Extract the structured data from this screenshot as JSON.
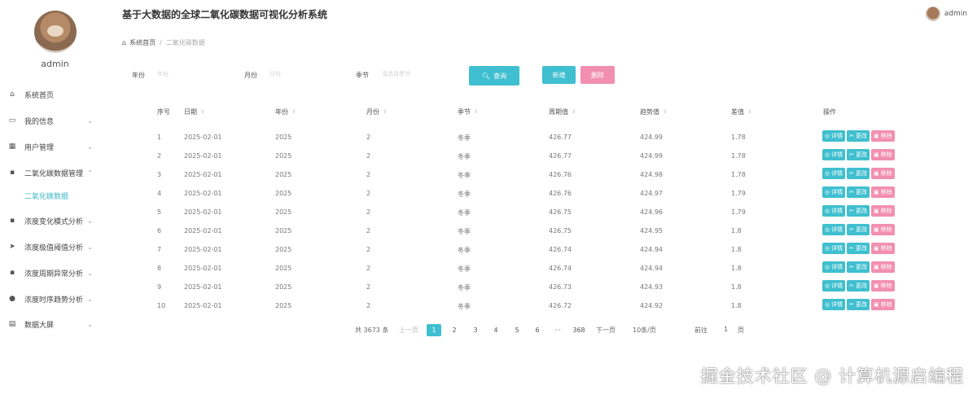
{
  "app": {
    "title": "基于大数据的全球二氧化碳数据可视化分析系统",
    "user": "admin"
  },
  "sidebar": {
    "user": "admin",
    "items": [
      {
        "label": "系统首页",
        "icon": "home-icon"
      },
      {
        "label": "我的信息",
        "icon": "calendar-icon"
      },
      {
        "label": "用户管理",
        "icon": "grid-icon"
      },
      {
        "label": "二氧化碳数据管理",
        "icon": "apps-icon"
      },
      {
        "label": "浓度变化模式分析",
        "icon": "apps-icon"
      },
      {
        "label": "浓度极值阈值分析",
        "icon": "send-icon"
      },
      {
        "label": "浓度周期异常分析",
        "icon": "apps-icon"
      },
      {
        "label": "浓度时序趋势分析",
        "icon": "user-icon"
      },
      {
        "label": "数据大屏",
        "icon": "chart-icon"
      }
    ],
    "sub_item": "二氧化碳数据"
  },
  "breadcrumb": {
    "home": "系统首页",
    "current": "二氧化碳数据"
  },
  "filters": {
    "year_label": "年份",
    "year_placeholder": "年份",
    "month_label": "月份",
    "month_placeholder": "月份",
    "season_label": "季节",
    "season_placeholder": "请选择季节"
  },
  "buttons": {
    "search": "查询",
    "add": "新增",
    "delete": "删除"
  },
  "table": {
    "headers": [
      "序号",
      "日期",
      "年份",
      "月份",
      "季节",
      "周期值",
      "趋势值",
      "差值",
      "操作"
    ],
    "rows": [
      [
        "1",
        "2025-02-01",
        "2025",
        "2",
        "冬季",
        "426.77",
        "424.99",
        "1.78"
      ],
      [
        "2",
        "2025-02-01",
        "2025",
        "2",
        "冬季",
        "426.77",
        "424.99",
        "1.78"
      ],
      [
        "3",
        "2025-02-01",
        "2025",
        "2",
        "冬季",
        "426.76",
        "424.98",
        "1.78"
      ],
      [
        "4",
        "2025-02-01",
        "2025",
        "2",
        "冬季",
        "426.76",
        "424.97",
        "1.79"
      ],
      [
        "5",
        "2025-02-01",
        "2025",
        "2",
        "冬季",
        "426.75",
        "424.96",
        "1.79"
      ],
      [
        "6",
        "2025-02-01",
        "2025",
        "2",
        "冬季",
        "426.75",
        "424.95",
        "1.8"
      ],
      [
        "7",
        "2025-02-01",
        "2025",
        "2",
        "冬季",
        "426.74",
        "424.94",
        "1.8"
      ],
      [
        "8",
        "2025-02-01",
        "2025",
        "2",
        "冬季",
        "426.74",
        "424.94",
        "1.8"
      ],
      [
        "9",
        "2025-02-01",
        "2025",
        "2",
        "冬季",
        "426.73",
        "424.93",
        "1.8"
      ],
      [
        "10",
        "2025-02-01",
        "2025",
        "2",
        "冬季",
        "426.72",
        "424.92",
        "1.8"
      ]
    ],
    "actions": {
      "detail": "详情",
      "edit": "更改",
      "remove": "移除"
    }
  },
  "pagination": {
    "total": "共 3673 条",
    "prev": "上一页",
    "pages": [
      "1",
      "2",
      "3",
      "4",
      "5",
      "6"
    ],
    "ellipsis": "···",
    "last": "368",
    "next": "下一页",
    "page_size": "10条/页",
    "goto_prefix": "前往",
    "goto_value": "1",
    "goto_suffix": "页"
  },
  "watermark": "掘金技术社区 @ 计算机源启编程",
  "colors": {
    "primary": "#3fbfcf",
    "danger": "#f28fb0",
    "active_menu": "#3fb7c5"
  }
}
